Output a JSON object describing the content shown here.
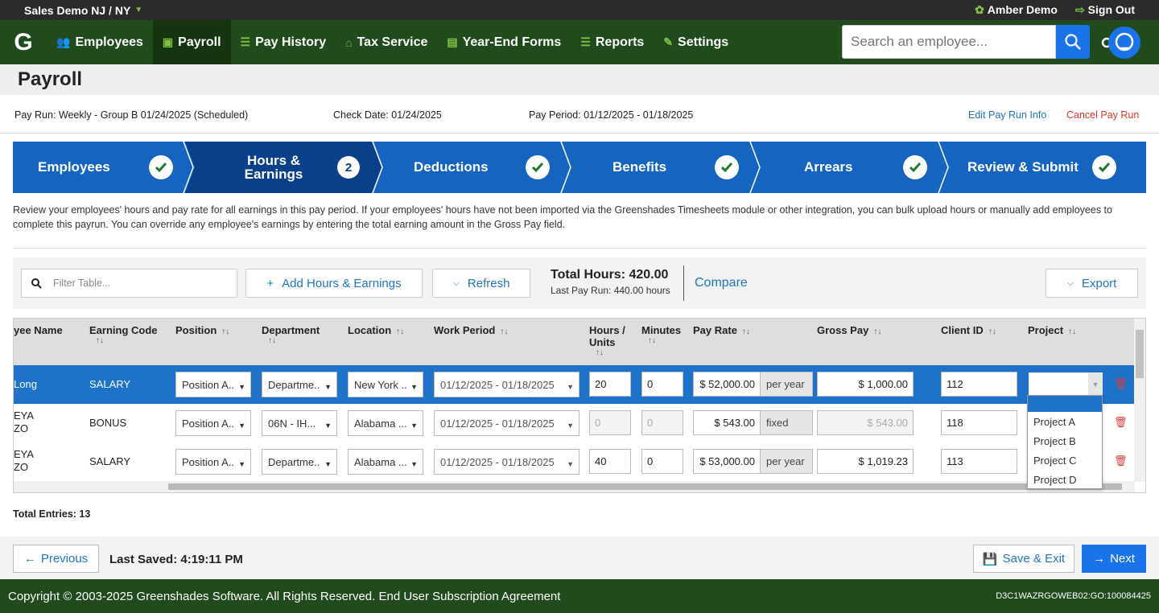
{
  "topbar": {
    "company": "Sales Demo NJ / NY",
    "user": "Amber Demo",
    "signout": "Sign Out"
  },
  "nav": {
    "logo": "G",
    "items": [
      {
        "label": "Employees",
        "icon": "users-icon"
      },
      {
        "label": "Payroll",
        "icon": "money-icon"
      },
      {
        "label": "Pay History",
        "icon": "list-icon"
      },
      {
        "label": "Tax Service",
        "icon": "bank-icon"
      },
      {
        "label": "Year-End Forms",
        "icon": "document-icon"
      },
      {
        "label": "Reports",
        "icon": "list-icon"
      },
      {
        "label": "Settings",
        "icon": "wrench-icon"
      }
    ],
    "search_placeholder": "Search an employee..."
  },
  "page": {
    "title": "Payroll"
  },
  "payrun": {
    "run": "Pay Run: Weekly - Group B 01/24/2025 (Scheduled)",
    "check_date": "Check Date: 01/24/2025",
    "period": "Pay Period: 01/12/2025 - 01/18/2025",
    "edit": "Edit Pay Run Info",
    "cancel": "Cancel Pay Run"
  },
  "steps": [
    {
      "label": "Employees",
      "status": "done"
    },
    {
      "label": "Hours &",
      "label2": "Earnings",
      "status": "current",
      "number": "2"
    },
    {
      "label": "Deductions",
      "status": "done"
    },
    {
      "label": "Benefits",
      "status": "done"
    },
    {
      "label": "Arrears",
      "status": "done"
    },
    {
      "label": "Review & Submit",
      "status": "done"
    }
  ],
  "description": "Review your employees' hours and pay rate for all earnings in this pay period. If your employees' hours have not been imported via the Greenshades Timesheets module or other integration, you can bulk upload hours or manually add employees to complete this payrun. You can override any employee's earnings by entering the total earning amount in the Gross Pay field.",
  "toolbar": {
    "filter_placeholder": "Filter Table...",
    "add": "Add Hours & Earnings",
    "refresh": "Refresh",
    "total_hours": "Total Hours: 420.00",
    "last_run": "Last Pay Run: 440.00 hours",
    "compare": "Compare",
    "export": "Export"
  },
  "table": {
    "columns": [
      "yee Name",
      "Earning Code",
      "Position",
      "Department",
      "Location",
      "Work Period",
      "Hours /",
      "Units",
      "Minutes",
      "Pay Rate",
      "Gross Pay",
      "Client ID",
      "Project"
    ],
    "rows": [
      {
        "name1": "Long",
        "name2": "",
        "code": "SALARY",
        "position": "Position A..",
        "department": "Departme..",
        "location": "New York ..",
        "period": "01/12/2025 - 01/18/2025",
        "hours": "20",
        "minutes": "0",
        "rate": "$ 52,000.00",
        "rate_unit": "per year",
        "gross": "$ 1,000.00",
        "client": "112",
        "project": ""
      },
      {
        "name1": "EYA",
        "name2": "ZO",
        "code": "BONUS",
        "position": "Position A..",
        "department": "06N - IH...",
        "location": "Alabama ...",
        "period": "01/12/2025 - 01/18/2025",
        "hours": "0",
        "minutes": "0",
        "rate": "$ 543.00",
        "rate_unit": "fixed",
        "gross": "$ 543.00",
        "client": "118",
        "project": ""
      },
      {
        "name1": "EYA",
        "name2": "ZO",
        "code": "SALARY",
        "position": "Position A..",
        "department": "Departme..",
        "location": "Alabama ...",
        "period": "01/12/2025 - 01/18/2025",
        "hours": "40",
        "minutes": "0",
        "rate": "$ 53,000.00",
        "rate_unit": "per year",
        "gross": "$ 1,019.23",
        "client": "113",
        "project": ""
      }
    ]
  },
  "project_menu": [
    "Project A",
    "Project B",
    "Project C",
    "Project D"
  ],
  "total_entries": "Total Entries: 13",
  "footer": {
    "previous": "Previous",
    "last_saved": "Last Saved: 4:19:11 PM",
    "save_exit": "Save & Exit",
    "next": "Next"
  },
  "copyright": {
    "text": "Copyright © 2003-2025 Greenshades Software. All Rights Reserved. End User Subscription Agreement",
    "build": "D3C1WAZRGOWEB02:GO:100084425"
  },
  "colors": {
    "brand_green": "#214a1d",
    "accent_green": "#7fc241",
    "primary_blue": "#1565c0",
    "danger_red": "#d9342b"
  }
}
